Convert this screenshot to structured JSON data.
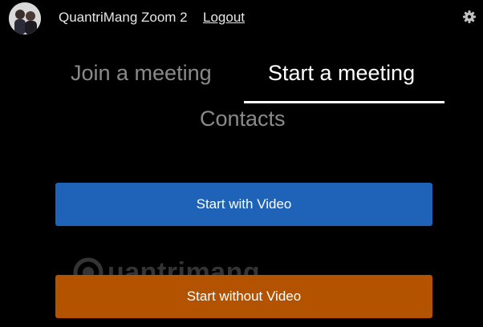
{
  "header": {
    "username": "QuantriMang Zoom 2",
    "logout_label": "Logout",
    "settings_icon": "gear-icon"
  },
  "tabs": [
    {
      "label": "Join a meeting",
      "active": false
    },
    {
      "label": "Start a meeting",
      "active": true
    },
    {
      "label": "Contacts",
      "active": false
    }
  ],
  "buttons": {
    "start_with_video": "Start with Video",
    "start_without_video": "Start without Video"
  },
  "watermark": {
    "text": "uantrimang"
  },
  "colors": {
    "background": "#000000",
    "video_button": "#1e63b8",
    "novideo_button": "#b35300",
    "active_tab": "#ffffff",
    "inactive_tab": "#8a8a8a"
  }
}
